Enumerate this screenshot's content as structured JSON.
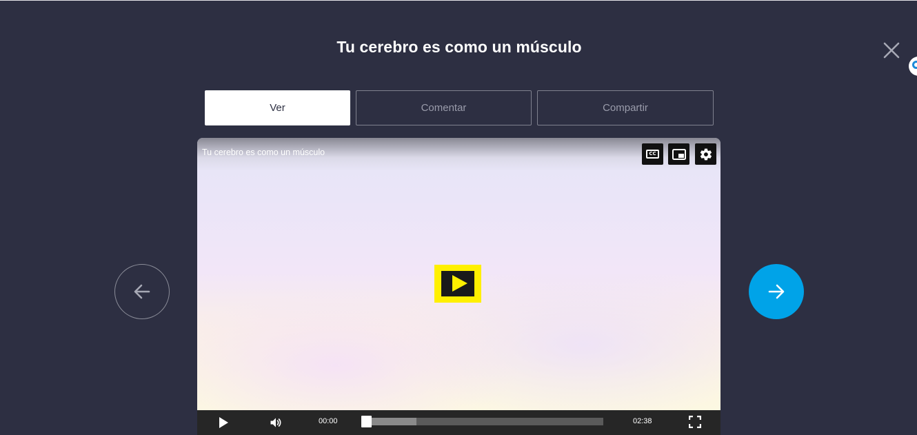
{
  "header": {
    "title": "Tu cerebro es como un músculo"
  },
  "tabs": [
    {
      "label": "Ver",
      "active": true
    },
    {
      "label": "Comentar",
      "active": false
    },
    {
      "label": "Compartir",
      "active": false
    }
  ],
  "video": {
    "title": "Tu cerebro es como un músculo",
    "current_time": "00:00",
    "duration": "02:38",
    "progress_fraction": 0.0,
    "buffered_fraction": 0.22,
    "top_buttons": [
      {
        "name": "cc-icon",
        "label": "CC"
      },
      {
        "name": "picture-in-picture-icon"
      },
      {
        "name": "gear-icon"
      }
    ]
  },
  "navigation": {
    "prev_icon": "arrow-left-icon",
    "next_icon": "arrow-right-icon"
  },
  "colors": {
    "background": "#2d2f42",
    "accent_next": "#00a3e8",
    "play_highlight": "#fff000",
    "active_tab_bg": "#ffffff"
  }
}
